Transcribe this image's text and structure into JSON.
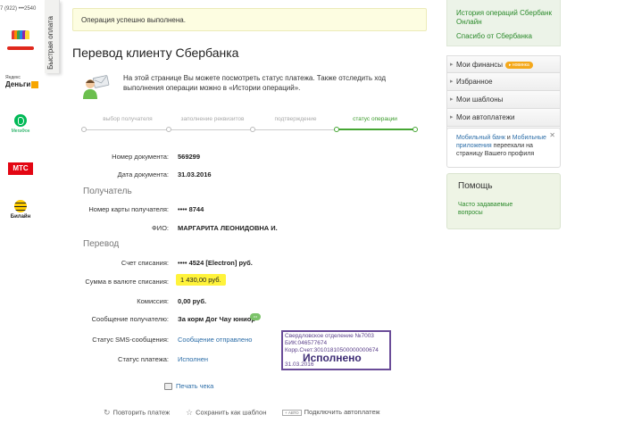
{
  "left_strip": {
    "phone": "7 (922) •••2540",
    "logos": {
      "yandex_small": "Яндекс",
      "yandex_big": "Деньги",
      "megafon": "МегаФон",
      "mts": "МТС",
      "beeline": "Билайн"
    }
  },
  "quick_pay_tab": "Быстрая оплата",
  "success_message": "Операция успешно выполнена.",
  "page_title": "Перевод клиенту Сбербанка",
  "intro_text": "На этой странице Вы можете посмотреть статус платежа. Также отследить ход выполнения операции можно в «Истории операций».",
  "steps": {
    "labels": [
      "выбор получателя",
      "заполнение реквизитов",
      "подтверждение",
      "статус операции"
    ],
    "active_index": 3
  },
  "document": {
    "number_label": "Номер документа:",
    "number_value": "569299",
    "date_label": "Дата документа:",
    "date_value": "31.03.2016"
  },
  "recipient": {
    "section_title": "Получатель",
    "card_label": "Номер карты получателя:",
    "card_value": "•••• 8744",
    "name_label": "ФИО:",
    "name_value": "МАРГАРИТА ЛЕОНИДОВНА И."
  },
  "transfer": {
    "section_title": "Перевод",
    "account_label": "Счет списания:",
    "account_value": "•••• 4524  [Electron]  руб.",
    "amount_label": "Сумма в валюте списания:",
    "amount_value": "1 430,00  руб.",
    "commission_label": "Комиссия:",
    "commission_value": "0,00 руб.",
    "message_label": "Сообщение получателю:",
    "message_value": "За корм Дог Чау юниор",
    "sms_label": "Статус SMS-сообщения:",
    "sms_value": "Сообщение отправлено",
    "status_label": "Статус платежа:",
    "status_value": "Исполнен"
  },
  "stamp": {
    "line1": "Свердловское отделение №7003",
    "line2": "БИК:046577674",
    "line3": "Корр.Счет:30101810500000000674",
    "status": "Исполнено",
    "date": "31.03.2016"
  },
  "print_label": "Печать чека",
  "actions": {
    "repeat": "Повторить платеж",
    "save_template": "Сохранить как шаблон",
    "auto_badge": "АВТО",
    "autopay": "Подключить автоплатеж"
  },
  "sidebar": {
    "history_link": "История операций Сбербанк Онлайн",
    "thanks_link": "Спасибо от Сбербанка",
    "menu": [
      {
        "label": "Мои финансы",
        "badge": "новинка"
      },
      {
        "label": "Избранное"
      },
      {
        "label": "Мои шаблоны"
      },
      {
        "label": "Мои автоплатежи"
      }
    ],
    "promo_text_1": "Мобильный банк",
    "promo_text_2": " и ",
    "promo_text_3": "Мобильные приложения",
    "promo_text_4": " переехали на страницу Вашего профиля",
    "help_title": "Помощь",
    "help_link": "Часто задаваемые вопросы"
  },
  "colors": {
    "accent_green": "#46a634",
    "link_blue": "#2d6ea8",
    "highlight_yellow": "#fff33b",
    "stamp_purple": "#5a3f8a"
  }
}
